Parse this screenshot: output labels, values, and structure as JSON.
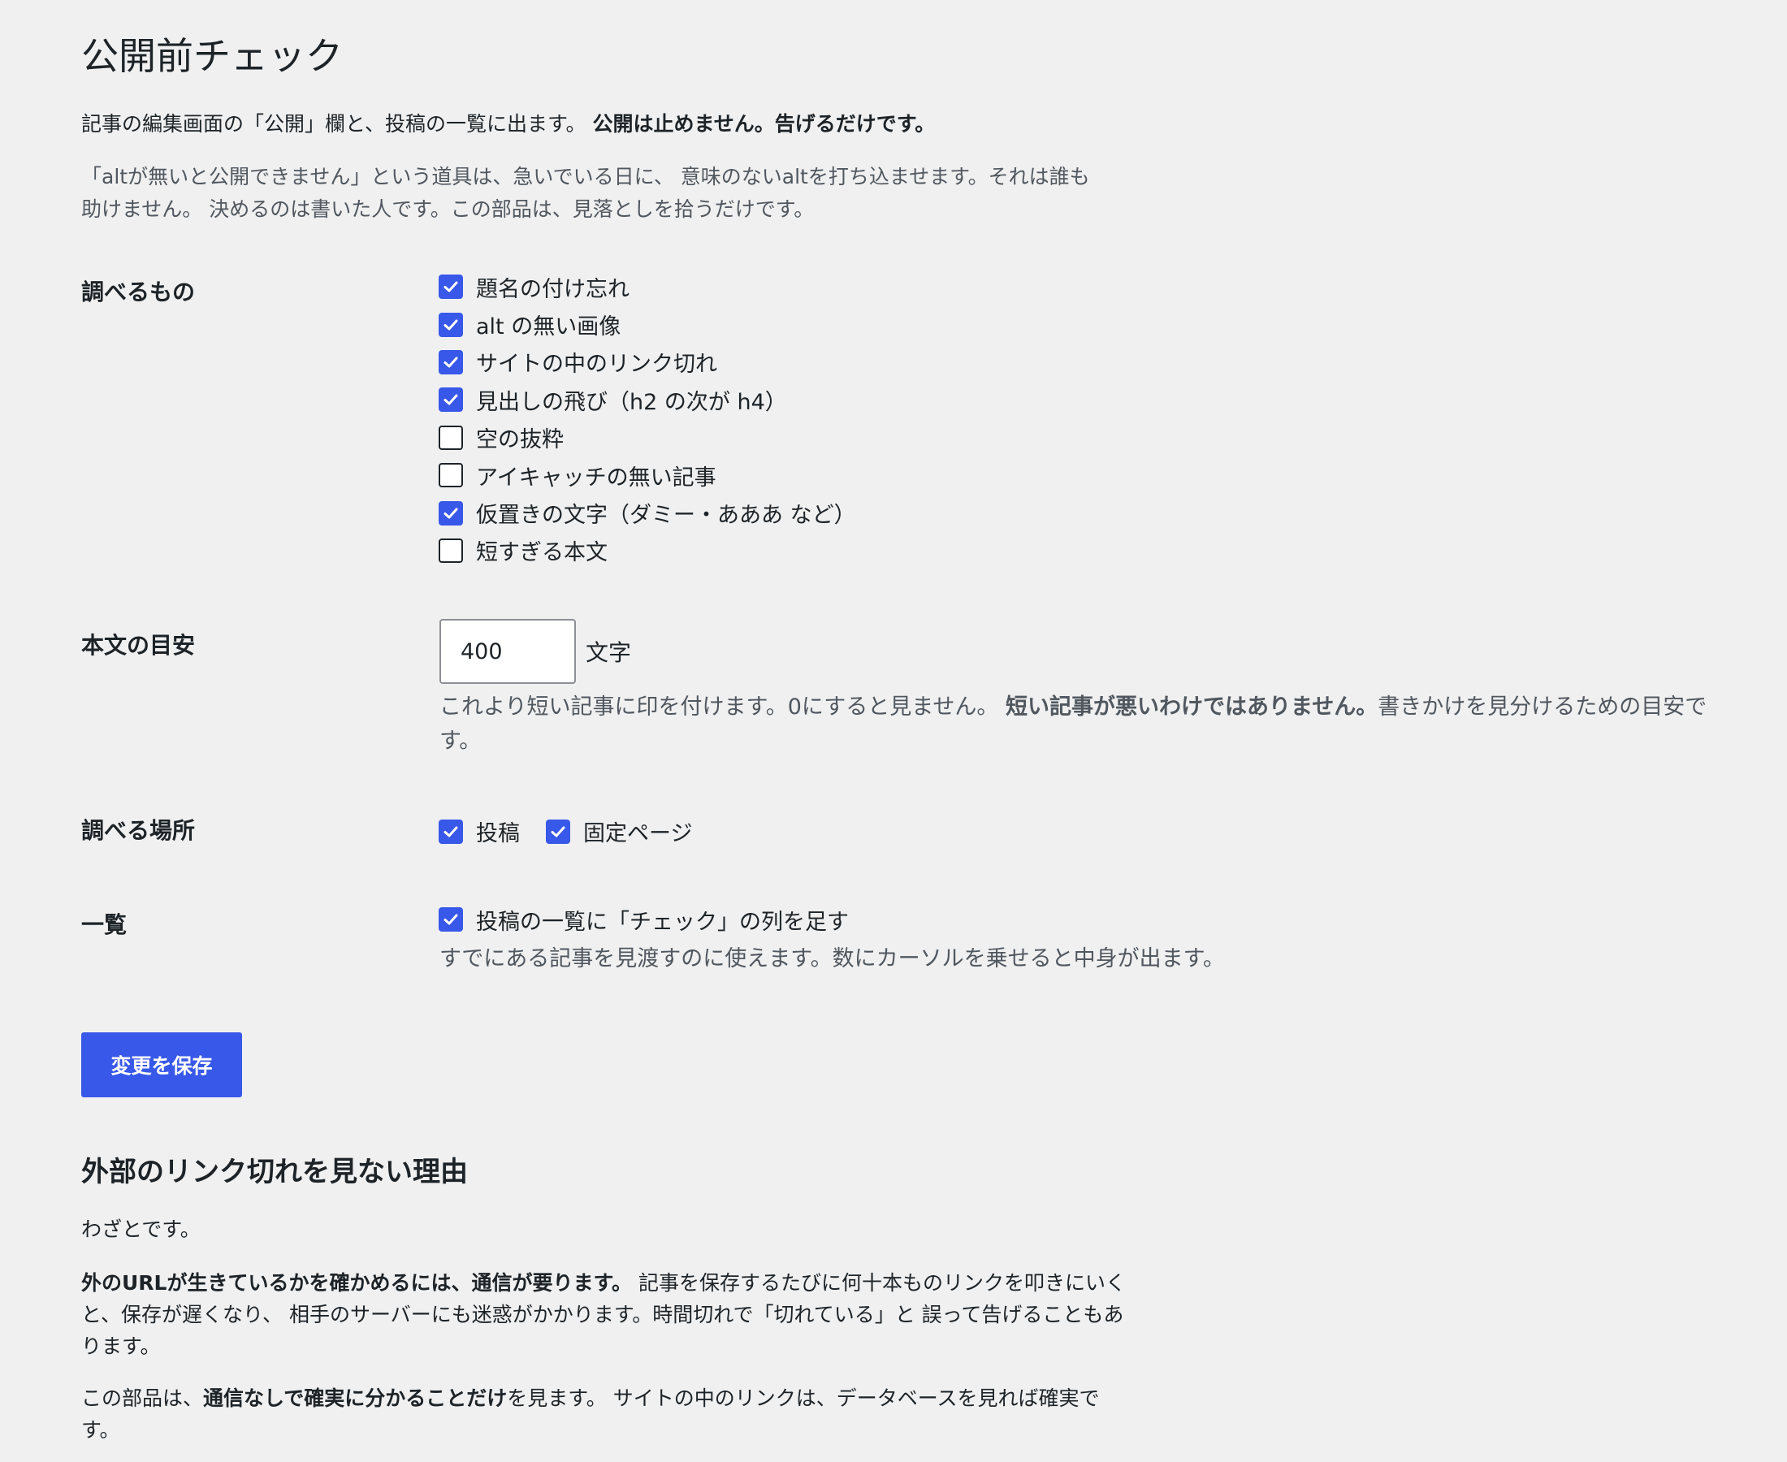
{
  "page": {
    "title": "公開前チェック",
    "intro_text": "記事の編集画面の「公開」欄と、投稿の一覧に出ます。",
    "intro_strong": "公開は止めません。告げるだけです。",
    "intro_note": "「altが無いと公開できません」という道具は、急いでいる日に、 意味のないaltを打ち込ませます。それは誰も助けません。 決めるのは書いた人です。この部品は、見落としを拾うだけです。"
  },
  "checks_section": {
    "label": "調べるもの",
    "items": [
      {
        "label": "題名の付け忘れ",
        "checked": true
      },
      {
        "label": "alt の無い画像",
        "checked": true
      },
      {
        "label": "サイトの中のリンク切れ",
        "checked": true
      },
      {
        "label": "見出しの飛び（h2 の次が h4）",
        "checked": true
      },
      {
        "label": "空の抜粋",
        "checked": false
      },
      {
        "label": "アイキャッチの無い記事",
        "checked": false
      },
      {
        "label": "仮置きの文字（ダミー・あああ など）",
        "checked": true
      },
      {
        "label": "短すぎる本文",
        "checked": false
      }
    ]
  },
  "length_section": {
    "label": "本文の目安",
    "value": "400",
    "unit": "文字",
    "help_pre": "これより短い記事に印を付けます。0にすると見ません。",
    "help_strong": "短い記事が悪いわけではありません。",
    "help_post": "書きかけを見分けるための目安です。"
  },
  "scope_section": {
    "label": "調べる場所",
    "items": [
      {
        "label": "投稿",
        "checked": true
      },
      {
        "label": "固定ページ",
        "checked": true
      }
    ]
  },
  "list_section": {
    "label": "一覧",
    "checkbox_label": "投稿の一覧に「チェック」の列を足す",
    "checked": true,
    "help": "すでにある記事を見渡すのに使えます。数にカーソルを乗せると中身が出ます。"
  },
  "save_button": {
    "label": "変更を保存"
  },
  "external": {
    "title": "外部のリンク切れを見ない理由",
    "p1": "わざとです。",
    "p2_strong": "外のURLが生きているかを確かめるには、通信が要ります。",
    "p2_rest": "記事を保存するたびに何十本ものリンクを叩きにいくと、保存が遅くなり、 相手のサーバーにも迷惑がかかります。時間切れで「切れている」と 誤って告げることもあります。",
    "p3_pre": "この部品は、",
    "p3_strong": "通信なしで確実に分かることだけ",
    "p3_post": "を見ます。 サイトの中のリンクは、データベースを見れば確実です。"
  },
  "colors": {
    "accent": "#3858e9",
    "background": "#f0f0f1",
    "text": "#1d2327",
    "muted_text": "#50575e"
  },
  "icons": {
    "checkbox_checked": "checkmark-icon"
  }
}
